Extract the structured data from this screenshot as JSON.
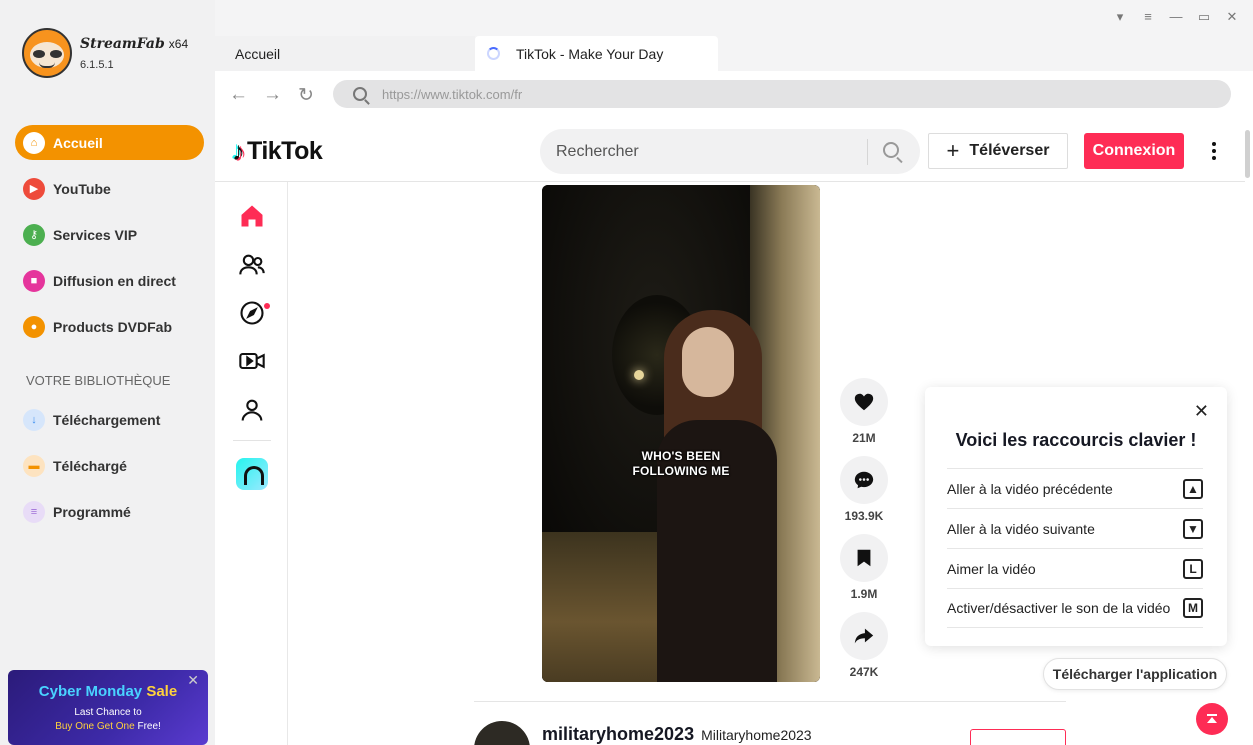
{
  "app": {
    "name": "StreamFab",
    "arch": "x64",
    "version": "6.1.5.1"
  },
  "sidebar": {
    "items": [
      {
        "label": "Accueil",
        "icon": "home-icon",
        "color": "#f39200"
      },
      {
        "label": "YouTube",
        "icon": "youtube-icon",
        "color": "#ee4b3b"
      },
      {
        "label": "Services VIP",
        "icon": "key-icon",
        "color": "#4caf50"
      },
      {
        "label": "Diffusion en direct",
        "icon": "live-camera-icon",
        "color": "#e5359c"
      },
      {
        "label": "Products DVDFab",
        "icon": "dvdfab-icon",
        "color": "#f39200"
      }
    ],
    "library_title": "VOTRE BIBLIOTHÈQUE",
    "library": [
      {
        "label": "Téléchargement",
        "icon": "download-icon",
        "color": "#3b8ef0"
      },
      {
        "label": "Téléchargé",
        "icon": "folder-icon",
        "color": "#f39200"
      },
      {
        "label": "Programmé",
        "icon": "schedule-icon",
        "color": "#a070d8"
      }
    ]
  },
  "promo": {
    "title_a": "Cyber Monday ",
    "title_b": "Sale",
    "line1": "Last Chance to",
    "line2_a": "Buy One Get One",
    "line2_b": " Free!"
  },
  "tabs": [
    {
      "label": "Accueil"
    },
    {
      "label": "TikTok - Make Your Day"
    }
  ],
  "address": {
    "placeholder": "https://www.tiktok.com/fr"
  },
  "tiktok": {
    "logo_text": "TikTok",
    "search_placeholder": "Rechercher",
    "upload_label": "Téléverser",
    "login_label": "Connexion",
    "video_caption_1": "WHO'S BEEN",
    "video_caption_2": "FOLLOWING ME",
    "actions": [
      {
        "icon": "heart-icon",
        "count": "21M"
      },
      {
        "icon": "comment-icon",
        "count": "193.9K"
      },
      {
        "icon": "bookmark-icon",
        "count": "1.9M"
      },
      {
        "icon": "share-icon",
        "count": "247K"
      }
    ],
    "shortcuts": {
      "title": "Voici les raccourcis clavier !",
      "rows": [
        {
          "label": "Aller à la vidéo précédente",
          "key": "▲"
        },
        {
          "label": "Aller à la vidéo suivante",
          "key": "▼"
        },
        {
          "label": "Aimer la vidéo",
          "key": "L"
        },
        {
          "label": "Activer/désactiver le son de la vidéo",
          "key": "M"
        }
      ]
    },
    "app_download_label": "Télécharger l'application",
    "next_post": {
      "username": "militaryhome2023",
      "nickname": "Militaryhome2023"
    },
    "accent_color": "#fe2c55"
  }
}
